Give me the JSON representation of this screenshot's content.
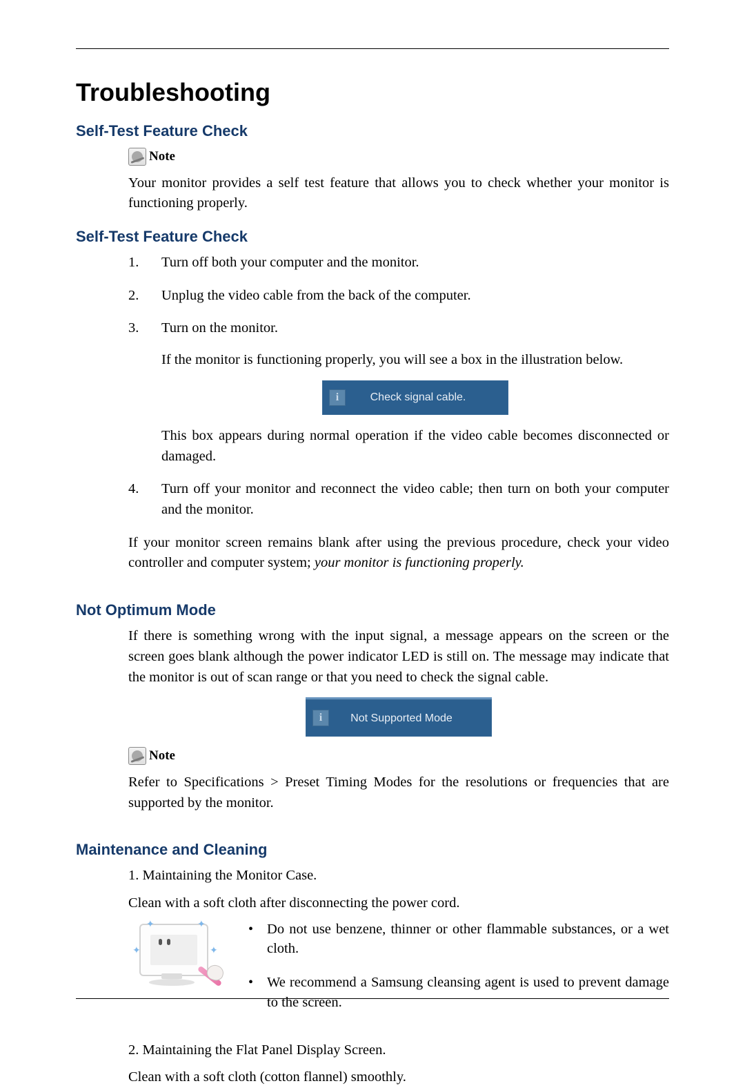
{
  "title": "Troubleshooting",
  "sections": {
    "selfTest1": {
      "heading": "Self-Test Feature Check",
      "noteLabel": "Note",
      "noteBody": "Your monitor provides a self test feature that allows you to check whether your monitor is functioning properly."
    },
    "selfTest2": {
      "heading": "Self-Test Feature Check",
      "steps": [
        "Turn off both your computer and the monitor.",
        "Unplug the video cable from the back of the computer.",
        "Turn on the monitor.",
        "Turn off your monitor and reconnect the video cable; then turn on both your computer and the monitor."
      ],
      "step3_sub1": "If the monitor is functioning properly, you will see a box in the illustration below.",
      "osd1": "Check signal cable.",
      "step3_sub2": "This box appears during normal operation if the video cable becomes disconnected or damaged.",
      "after": "If your monitor screen remains blank after using the previous procedure, check your video controller and computer system; ",
      "afterItalic": "your monitor is functioning properly."
    },
    "notOptimum": {
      "heading": "Not Optimum Mode",
      "body": "If there is something wrong with the input signal, a message appears on the screen or the screen goes blank although the power indicator LED is still on. The message may indicate that the monitor is out of scan range or that you need to check the signal cable.",
      "osd2": "Not Supported Mode",
      "noteLabel": "Note",
      "noteBody": "Refer to Specifications > Preset Timing Modes for the resolutions or frequencies that are supported by the monitor."
    },
    "maintenance": {
      "heading": "Maintenance and Cleaning",
      "item1_label": "1. Maintaining the Monitor Case.",
      "item1_body": "Clean with a soft cloth after disconnecting the power cord.",
      "tips": [
        "Do not use benzene, thinner or other flammable substances, or a wet cloth.",
        "We recommend a Samsung cleansing agent is used to prevent damage to the screen."
      ],
      "item2_label": "2. Maintaining the Flat Panel Display Screen.",
      "item2_body": "Clean with a soft cloth (cotton flannel) smoothly."
    }
  }
}
